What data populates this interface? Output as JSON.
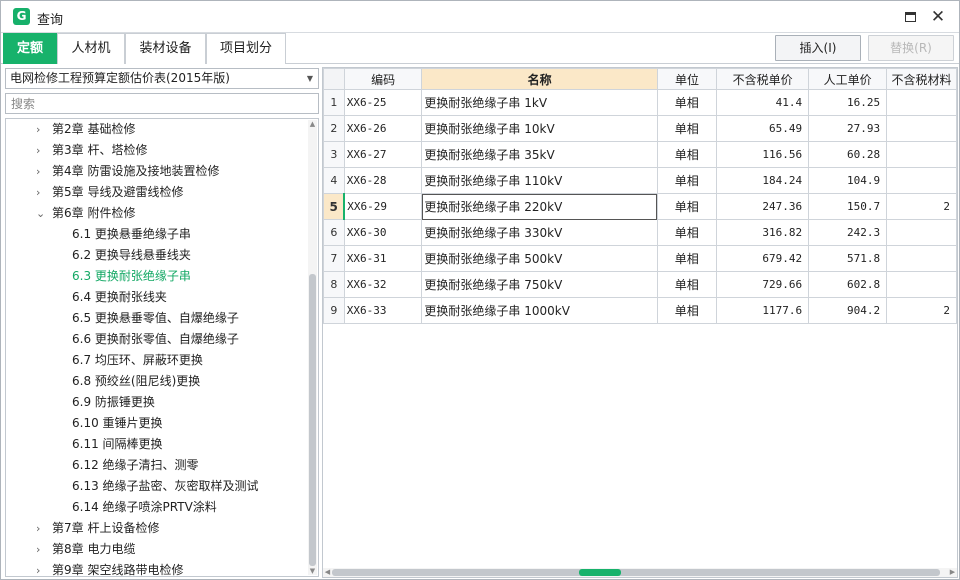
{
  "window": {
    "logo_letter": "G",
    "title": "查询",
    "maximize_icon": "maximize-icon",
    "close_glyph": "✕"
  },
  "tabs": [
    {
      "label": "定额",
      "active": true
    },
    {
      "label": "人材机",
      "active": false
    },
    {
      "label": "装材设备",
      "active": false
    },
    {
      "label": "项目划分",
      "active": false
    }
  ],
  "toolbar": {
    "insert_label": "插入(I)",
    "replace_label": "替换(R)"
  },
  "left": {
    "dropdown_value": "电网检修工程预算定额估价表(2015年版)",
    "search_placeholder": "搜索",
    "tree": [
      {
        "label": "第2章  基础检修",
        "level": 0,
        "expanded": false
      },
      {
        "label": "第3章  杆、塔检修",
        "level": 0,
        "expanded": false
      },
      {
        "label": "第4章  防雷设施及接地装置检修",
        "level": 0,
        "expanded": false
      },
      {
        "label": "第5章  导线及避雷线检修",
        "level": 0,
        "expanded": false
      },
      {
        "label": "第6章  附件检修",
        "level": 0,
        "expanded": true
      },
      {
        "label": "6.1  更换悬垂绝缘子串",
        "level": 1
      },
      {
        "label": "6.2  更换导线悬垂线夹",
        "level": 1
      },
      {
        "label": "6.3  更换耐张绝缘子串",
        "level": 1,
        "selected": true
      },
      {
        "label": "6.4  更换耐张线夹",
        "level": 1
      },
      {
        "label": "6.5  更换悬垂零值、自爆绝缘子",
        "level": 1
      },
      {
        "label": "6.6  更换耐张零值、自爆绝缘子",
        "level": 1
      },
      {
        "label": "6.7  均压环、屏蔽环更换",
        "level": 1
      },
      {
        "label": "6.8  预绞丝(阻尼线)更换",
        "level": 1
      },
      {
        "label": "6.9  防振锤更换",
        "level": 1
      },
      {
        "label": "6.10  重锤片更换",
        "level": 1
      },
      {
        "label": "6.11  间隔棒更换",
        "level": 1
      },
      {
        "label": "6.12  绝缘子清扫、测零",
        "level": 1
      },
      {
        "label": "6.13  绝缘子盐密、灰密取样及测试",
        "level": 1
      },
      {
        "label": "6.14  绝缘子喷涂PRTV涂料",
        "level": 1
      },
      {
        "label": "第7章  杆上设备检修",
        "level": 0,
        "expanded": false
      },
      {
        "label": "第8章  电力电缆",
        "level": 0,
        "expanded": false
      },
      {
        "label": "第9章  架空线路带电检修",
        "level": 0,
        "expanded": false
      }
    ]
  },
  "table": {
    "columns": [
      "",
      "编码",
      "名称",
      "单位",
      "不含税单价",
      "人工单价",
      "不含税材料"
    ],
    "active_row": 4,
    "rows": [
      {
        "n": "1",
        "code": "XX6-25",
        "name": "更换耐张绝缘子串 1kV",
        "unit": "单相",
        "price": "41.4",
        "labor": "16.25",
        "material": ""
      },
      {
        "n": "2",
        "code": "XX6-26",
        "name": "更换耐张绝缘子串 10kV",
        "unit": "单相",
        "price": "65.49",
        "labor": "27.93",
        "material": ""
      },
      {
        "n": "3",
        "code": "XX6-27",
        "name": "更换耐张绝缘子串 35kV",
        "unit": "单相",
        "price": "116.56",
        "labor": "60.28",
        "material": ""
      },
      {
        "n": "4",
        "code": "XX6-28",
        "name": "更换耐张绝缘子串 110kV",
        "unit": "单相",
        "price": "184.24",
        "labor": "104.9",
        "material": ""
      },
      {
        "n": "5",
        "code": "XX6-29",
        "name": "更换耐张绝缘子串 220kV",
        "unit": "单相",
        "price": "247.36",
        "labor": "150.7",
        "material": "2"
      },
      {
        "n": "6",
        "code": "XX6-30",
        "name": "更换耐张绝缘子串 330kV",
        "unit": "单相",
        "price": "316.82",
        "labor": "242.3",
        "material": ""
      },
      {
        "n": "7",
        "code": "XX6-31",
        "name": "更换耐张绝缘子串 500kV",
        "unit": "单相",
        "price": "679.42",
        "labor": "571.8",
        "material": ""
      },
      {
        "n": "8",
        "code": "XX6-32",
        "name": "更换耐张绝缘子串 750kV",
        "unit": "单相",
        "price": "729.66",
        "labor": "602.8",
        "material": ""
      },
      {
        "n": "9",
        "code": "XX6-33",
        "name": "更换耐张绝缘子串 1000kV",
        "unit": "单相",
        "price": "1177.6",
        "labor": "904.2",
        "material": "2"
      }
    ]
  },
  "colors": {
    "accent": "#17b26b",
    "header_highlight": "#fbe8c8"
  }
}
